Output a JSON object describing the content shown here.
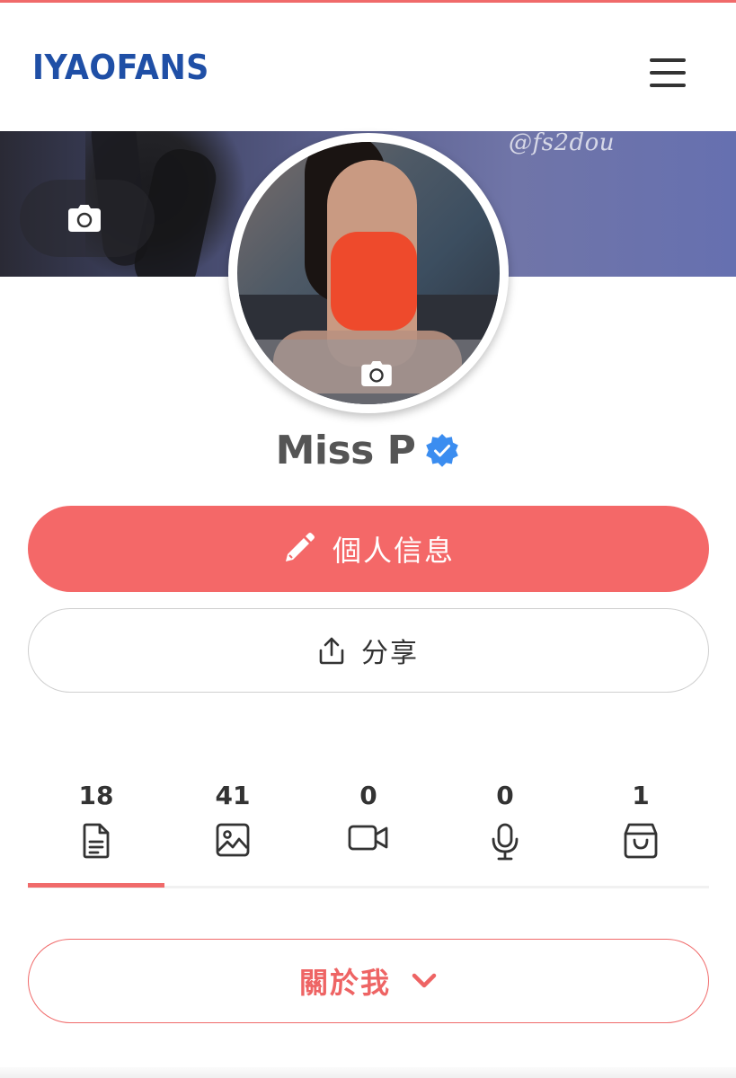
{
  "brand": {
    "logo": "IYAOFANS",
    "color": "#1f4fa6",
    "accent": "#f46868"
  },
  "header": {
    "menu_icon": "hamburger-menu-icon"
  },
  "cover": {
    "watermark": "@fs2dou",
    "camera_icon": "camera-icon"
  },
  "avatar": {
    "camera_icon": "camera-icon"
  },
  "profile": {
    "name": "Miss P",
    "verified_icon": "verified-badge-icon"
  },
  "actions": {
    "edit_label": "個人信息",
    "edit_icon": "pencil-icon",
    "share_label": "分享",
    "share_icon": "share-upload-icon"
  },
  "stats": [
    {
      "count": "18",
      "icon": "document-icon"
    },
    {
      "count": "41",
      "icon": "image-icon"
    },
    {
      "count": "0",
      "icon": "video-camera-icon"
    },
    {
      "count": "0",
      "icon": "microphone-icon"
    },
    {
      "count": "1",
      "icon": "shopping-bag-icon"
    }
  ],
  "stats_active_index": 0,
  "about": {
    "label": "關於我",
    "icon": "chevron-down-icon"
  }
}
